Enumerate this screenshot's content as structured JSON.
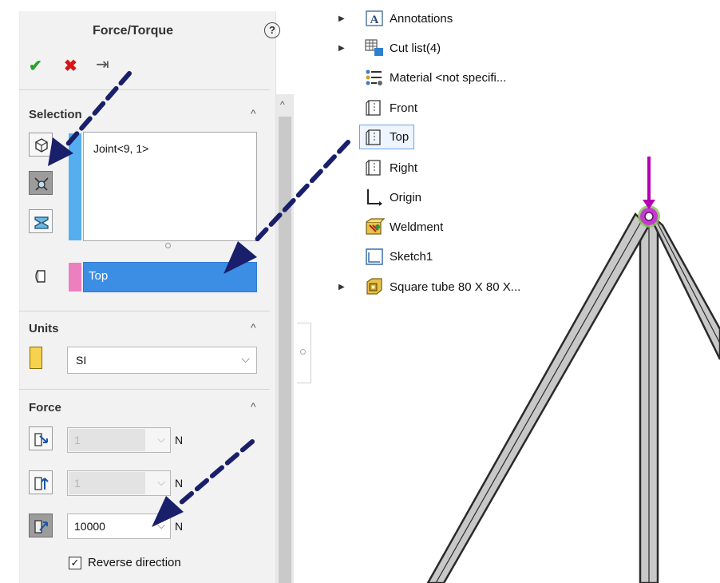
{
  "property_manager": {
    "title": "Force/Torque",
    "help_label": "?",
    "selection": {
      "header": "Selection",
      "list_items": [
        "Joint<9, 1>"
      ],
      "direction_value": "Top"
    },
    "units": {
      "header": "Units",
      "selected": "SI"
    },
    "force": {
      "header": "Force",
      "x_value": "1",
      "y_value": "1",
      "normal_value": "10000",
      "unit": "N",
      "reverse_direction_label": "Reverse direction",
      "reverse_direction_checked": true
    }
  },
  "feature_tree": {
    "items": [
      {
        "label": "Annotations",
        "icon": "annotations-icon",
        "expandable": true
      },
      {
        "label": "Cut list(4)",
        "icon": "cut-list-icon",
        "expandable": true
      },
      {
        "label": "Material <not specifi...",
        "icon": "material-icon",
        "expandable": false
      },
      {
        "label": "Front",
        "icon": "plane-icon",
        "expandable": false
      },
      {
        "label": "Top",
        "icon": "plane-icon",
        "expandable": false,
        "selected": true
      },
      {
        "label": "Right",
        "icon": "plane-icon",
        "expandable": false
      },
      {
        "label": "Origin",
        "icon": "origin-icon",
        "expandable": false
      },
      {
        "label": "Weldment",
        "icon": "weldment-icon",
        "expandable": false
      },
      {
        "label": "Sketch1",
        "icon": "sketch-icon",
        "expandable": false
      },
      {
        "label": "Square tube 80 X 80 X...",
        "icon": "structural-member-icon",
        "expandable": true
      }
    ]
  },
  "colors": {
    "accent_blue": "#3c8ee5",
    "selection_strip": "#55aef0",
    "direction_swatch": "#ec7fc0",
    "force_arrow": "#b300b3",
    "annotation_arrow": "#1a1f6b"
  }
}
